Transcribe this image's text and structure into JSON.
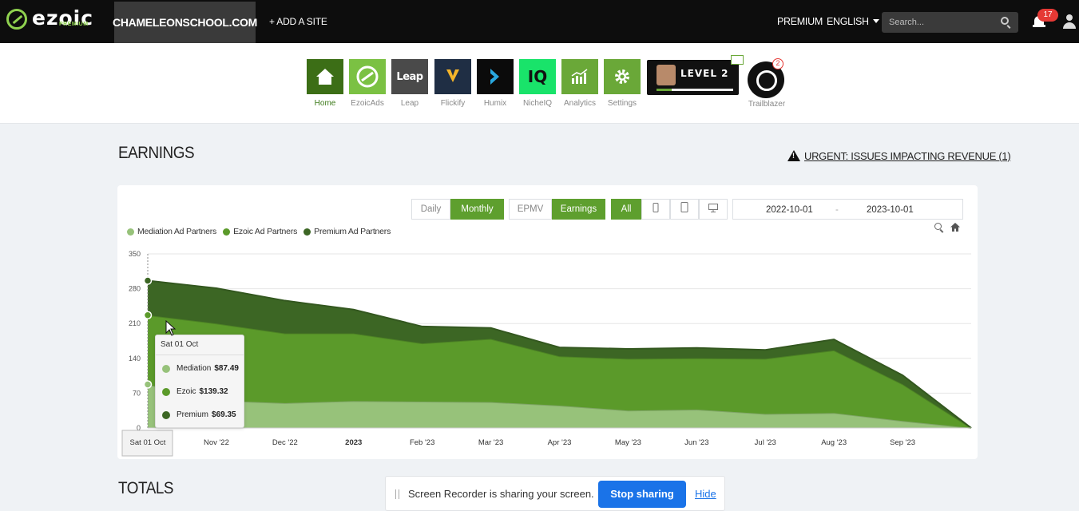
{
  "topbar": {
    "logo": "ezoic",
    "logo_sub": "PREMIUM",
    "site": "CHAMELEONSCHOOL.COM",
    "add_site": "+ ADD A SITE",
    "premium": "PREMIUM",
    "language": "ENGLISH",
    "search_placeholder": "Search...",
    "notifications": "17"
  },
  "apps": [
    {
      "label": "Home",
      "icon": "home-icon",
      "color": "#3c6e16",
      "active": true
    },
    {
      "label": "EzoicAds",
      "icon": "ezoicads-icon",
      "color": "#7bc143",
      "active": false
    },
    {
      "label": "Leap",
      "icon": "leap-icon",
      "color": "#4a4a4a",
      "active": false,
      "tile_text": "Leap"
    },
    {
      "label": "Flickify",
      "icon": "flickify-icon",
      "color": "#1f2e44",
      "active": false
    },
    {
      "label": "Humix",
      "icon": "humix-icon",
      "color": "#0b0b0b",
      "active": false
    },
    {
      "label": "NicheIQ",
      "icon": "nicheiq-icon",
      "color": "#19e36a",
      "active": false,
      "tile_text": "IQ"
    },
    {
      "label": "Analytics",
      "icon": "analytics-icon",
      "color": "#6aa838",
      "active": false
    },
    {
      "label": "Settings",
      "icon": "gear-icon",
      "color": "#6aa838",
      "active": false
    }
  ],
  "level": {
    "text": "LEVEL 2",
    "progress": 0.2
  },
  "trailblazer": {
    "label": "Trailblazer",
    "badge": "2"
  },
  "earnings": {
    "title": "EARNINGS",
    "urgent": "URGENT: ISSUES IMPACTING REVENUE (1)",
    "toggles": {
      "daily": "Daily",
      "monthly": "Monthly",
      "epmv": "EPMV",
      "earnings": "Earnings",
      "all": "All"
    },
    "date_from": "2022-10-01",
    "date_sep": "-",
    "date_to": "2023-10-01"
  },
  "chart_data": {
    "type": "area",
    "stacked": true,
    "ylim": [
      0,
      350
    ],
    "yticks": [
      0,
      70,
      140,
      210,
      280,
      350
    ],
    "categories": [
      "Sat 01 Oct",
      "Nov '22",
      "Dec '22",
      "2023",
      "Feb '23",
      "Mar '23",
      "Apr '23",
      "May '23",
      "Jun '23",
      "Jul '23",
      "Aug '23",
      "Sep '23",
      ""
    ],
    "series": [
      {
        "name": "Mediation Ad Partners",
        "color": "#97c27a",
        "values": [
          87.49,
          55,
          50,
          54,
          53,
          52,
          45,
          35,
          37,
          28,
          30,
          14,
          0
        ]
      },
      {
        "name": "Ezoic Ad Partners",
        "color": "#5b9a2a",
        "values": [
          139.32,
          155,
          140,
          136,
          117,
          127,
          99,
          104,
          103,
          111,
          126,
          74,
          0
        ]
      },
      {
        "name": "Premium Ad Partners",
        "color": "#3c6624",
        "values": [
          69.35,
          71,
          66,
          48,
          34,
          22,
          18,
          20,
          21,
          18,
          22,
          18,
          0
        ]
      }
    ],
    "legend_position": "top-left",
    "grid": true
  },
  "tooltip": {
    "date": "Sat 01 Oct",
    "rows": [
      {
        "label": "Mediation",
        "value": "$87.49",
        "color": "#97c27a"
      },
      {
        "label": "Ezoic",
        "value": "$139.32",
        "color": "#5b9a2a"
      },
      {
        "label": "Premium",
        "value": "$69.35",
        "color": "#3c6624"
      }
    ]
  },
  "totals": {
    "title": "TOTALS"
  },
  "share_bar": {
    "text": "Screen Recorder is sharing your screen.",
    "stop": "Stop sharing",
    "hide": "Hide"
  }
}
